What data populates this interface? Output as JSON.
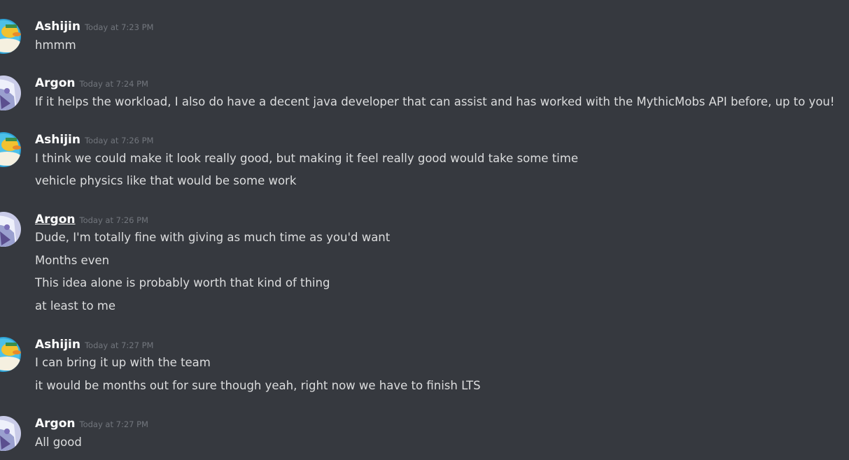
{
  "colors": {
    "background": "#36393f",
    "username": "#ffffff",
    "timestamp": "#72767d",
    "message_text": "#dcddde"
  },
  "messages": [
    {
      "author": "Ashijin",
      "avatar_icon": "duck-pilot-avatar-icon",
      "timestamp": "Today at 7:23 PM",
      "lines": [
        "hmmm"
      ]
    },
    {
      "author": "Argon",
      "avatar_icon": "anime-character-avatar-icon",
      "timestamp": "Today at 7:24 PM",
      "lines": [
        "If it helps the workload, I also do have a decent java developer that can assist and has worked with the MythicMobs API before, up to you!"
      ]
    },
    {
      "author": "Ashijin",
      "avatar_icon": "duck-pilot-avatar-icon",
      "timestamp": "Today at 7:26 PM",
      "lines": [
        "I think we could make it look really good, but making it feel really good would take some time",
        "vehicle physics like that would be some work"
      ]
    },
    {
      "author": "Argon",
      "avatar_icon": "anime-character-avatar-icon",
      "timestamp": "Today at 7:26 PM",
      "lines": [
        "Dude, I'm totally fine with giving as much time as you'd want",
        "Months even",
        "This idea alone is probably worth that kind of thing",
        "at least to me"
      ]
    },
    {
      "author": "Ashijin",
      "avatar_icon": "duck-pilot-avatar-icon",
      "timestamp": "Today at 7:27 PM",
      "lines": [
        "I can bring it up with the team",
        "it would be months out for sure though yeah, right now we have to finish LTS"
      ]
    },
    {
      "author": "Argon",
      "avatar_icon": "anime-character-avatar-icon",
      "timestamp": "Today at 7:27 PM",
      "lines": [
        "All good"
      ]
    }
  ]
}
